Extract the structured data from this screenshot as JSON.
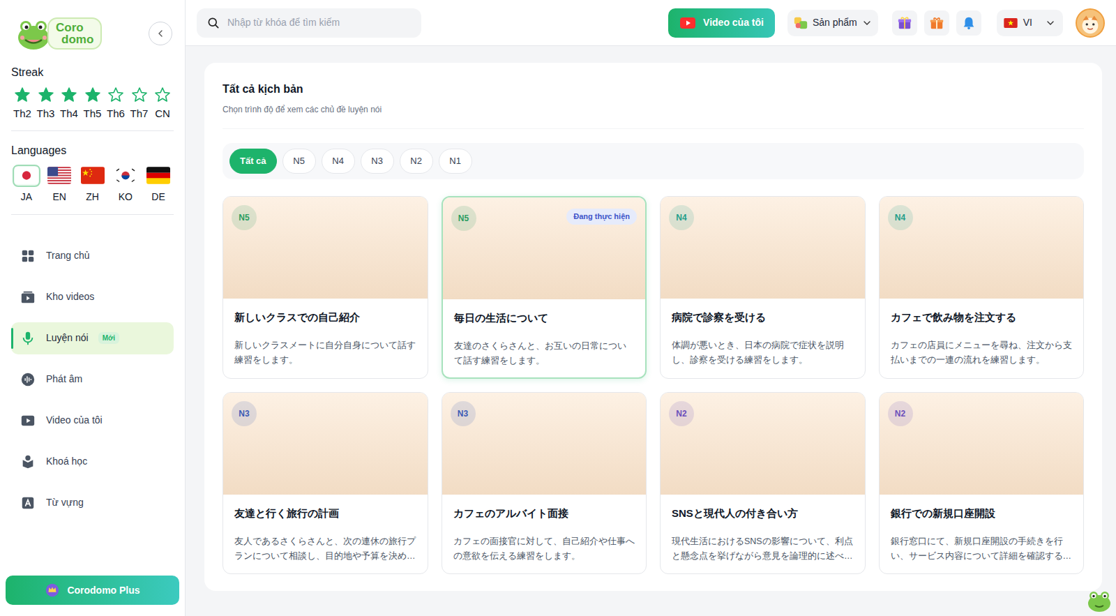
{
  "logo": {
    "line1": "Coro",
    "line2": "domo"
  },
  "streak": {
    "title": "Streak",
    "days": [
      {
        "label": "Th2",
        "done": true
      },
      {
        "label": "Th3",
        "done": true
      },
      {
        "label": "Th4",
        "done": true
      },
      {
        "label": "Th5",
        "done": true
      },
      {
        "label": "Th6",
        "done": false
      },
      {
        "label": "Th7",
        "done": false
      },
      {
        "label": "CN",
        "done": false
      }
    ]
  },
  "languages": {
    "title": "Languages",
    "items": [
      {
        "code": "JA",
        "selected": true
      },
      {
        "code": "EN",
        "selected": false
      },
      {
        "code": "ZH",
        "selected": false
      },
      {
        "code": "KO",
        "selected": false
      },
      {
        "code": "DE",
        "selected": false
      }
    ]
  },
  "sidebar": {
    "items": [
      {
        "label": "Trang chủ",
        "selected": false
      },
      {
        "label": "Kho videos",
        "selected": false
      },
      {
        "label": "Luyện nói",
        "selected": true,
        "badge": "Mới"
      },
      {
        "label": "Phát âm",
        "selected": false
      },
      {
        "label": "Video của tôi",
        "selected": false
      },
      {
        "label": "Khoá học",
        "selected": false
      },
      {
        "label": "Từ vựng",
        "selected": false
      }
    ]
  },
  "plus_button": "Corodomo Plus",
  "search": {
    "placeholder": "Nhập từ khóa để tìm kiếm"
  },
  "topbar": {
    "video_button": "Video của tôi",
    "products": "Sản phẩm",
    "language": "VI"
  },
  "content": {
    "title": "Tất cả kịch bản",
    "subtitle": "Chọn trình độ để xem các chủ đề luyện nói"
  },
  "filters": [
    {
      "label": "Tất cả",
      "selected": true
    },
    {
      "label": "N5",
      "selected": false
    },
    {
      "label": "N4",
      "selected": false
    },
    {
      "label": "N3",
      "selected": false
    },
    {
      "label": "N2",
      "selected": false
    },
    {
      "label": "N1",
      "selected": false
    }
  ],
  "scenarios": [
    {
      "level": "N5",
      "color": "#2a9d60",
      "title": "新しいクラスでの自己紹介",
      "description": "新しいクラスメートに自分自身について話す練習をします。",
      "in_progress": false
    },
    {
      "level": "N5",
      "color": "#2a9d60",
      "title": "毎日の生活について",
      "description": "友達のさくらさんと、お互いの日常について話す練習をします。",
      "in_progress": true,
      "status": "Đang thực hiện"
    },
    {
      "level": "N4",
      "color": "#1f9e8a",
      "title": "病院で診察を受ける",
      "description": "体調が悪いとき、日本の病院で症状を説明し、診察を受ける練習をします。",
      "in_progress": false
    },
    {
      "level": "N4",
      "color": "#1f9e8a",
      "title": "カフェで飲み物を注文する",
      "description": "カフェの店員にメニューを尋ね、注文から支払いまでの一連の流れを練習します。",
      "in_progress": false
    },
    {
      "level": "N3",
      "color": "#3b5bb5",
      "title": "友達と行く旅行の計画",
      "description": "友人であるさくらさんと、次の連休の旅行プランについて相談し、目的地や予算を決め…",
      "in_progress": false
    },
    {
      "level": "N3",
      "color": "#3b5bb5",
      "title": "カフェのアルバイト面接",
      "description": "カフェの面接官に対して、自己紹介や仕事への意欲を伝える練習をします。",
      "in_progress": false
    },
    {
      "level": "N2",
      "color": "#6b4fbb",
      "title": "SNSと現代人の付き合い方",
      "description": "現代生活におけるSNSの影響について、利点と懸念点を挙げながら意見を論理的に述べ…",
      "in_progress": false
    },
    {
      "level": "N2",
      "color": "#6b4fbb",
      "title": "銀行での新規口座開設",
      "description": "銀行窓口にて、新規口座開設の手続きを行い、サービス内容について詳細を確認する…",
      "in_progress": false
    }
  ]
}
